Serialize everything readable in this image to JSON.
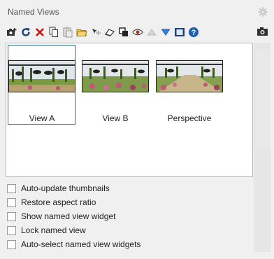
{
  "panel": {
    "title": "Named Views"
  },
  "toolbar": {
    "buttons": [
      {
        "icon": "camera-add-icon"
      },
      {
        "icon": "refresh-icon"
      },
      {
        "icon": "delete-x-icon"
      },
      {
        "icon": "copy-icon"
      },
      {
        "icon": "paste-icon"
      },
      {
        "icon": "open-folder-icon"
      },
      {
        "icon": "select-icon"
      },
      {
        "icon": "view-perspective-icon"
      },
      {
        "icon": "layers-icon"
      },
      {
        "icon": "eye-icon"
      },
      {
        "icon": "move-up-icon"
      },
      {
        "icon": "move-down-icon"
      },
      {
        "icon": "film-icon"
      },
      {
        "icon": "help-icon"
      }
    ]
  },
  "views": [
    {
      "label": "View A",
      "selected": true
    },
    {
      "label": "View B",
      "selected": false
    },
    {
      "label": "Perspective",
      "selected": false
    }
  ],
  "options": [
    {
      "label": "Auto-update thumbnails",
      "checked": false
    },
    {
      "label": "Restore aspect ratio",
      "checked": false
    },
    {
      "label": "Show named view widget",
      "checked": false
    },
    {
      "label": "Lock named view",
      "checked": false
    },
    {
      "label": "Auto-select named view widgets",
      "checked": false
    }
  ],
  "colors": {
    "accent_red": "#d01010",
    "accent_blue": "#1d5fb0",
    "selection_border": "#2b6d8c"
  }
}
